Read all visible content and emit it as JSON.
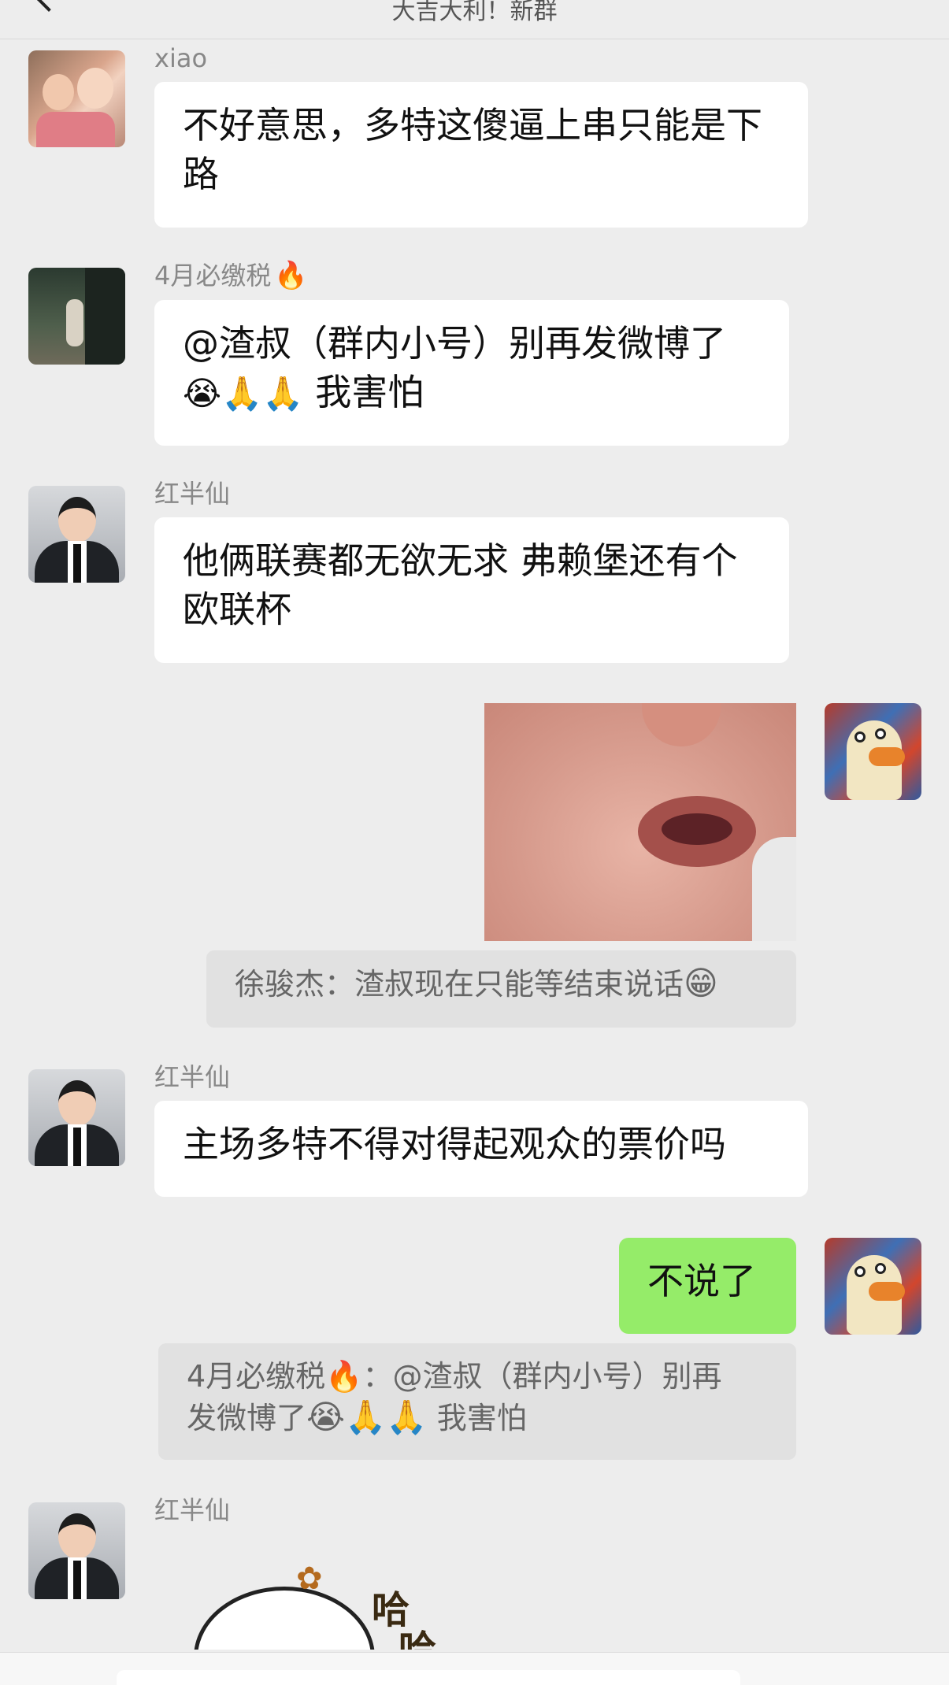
{
  "header": {
    "title": "大吉大利！新群"
  },
  "messages": [
    {
      "sender": "xiao",
      "text": "不好意思，多特这傻逼上串只能是下路"
    },
    {
      "sender": "4月必缴税",
      "sender_emoji": "🔥",
      "text": "@渣叔（群内小号）别再发微博了",
      "emojis": "😭🙏🙏",
      "text_after": "我害怕"
    },
    {
      "sender": "红半仙",
      "text": "他俩联赛都无欲无求  弗赖堡还有个欧联杯"
    },
    {
      "sender": "me",
      "image": "baby-mouth-photo",
      "quote": "徐骏杰：渣叔现在只能等结束说话",
      "quote_emoji": "😁"
    },
    {
      "sender": "红半仙",
      "text": "主场多特不得对得起观众的票价吗"
    },
    {
      "sender": "me",
      "text": "不说了",
      "quote_line1": "4月必缴税🔥：@渣叔（群内小号）别再",
      "quote_line2_text": "发微博了",
      "quote_line2_emojis": "😭🙏🙏",
      "quote_line2_after": "我害怕"
    },
    {
      "sender": "红半仙",
      "sticker": "haha-sticker",
      "sticker_text_1": "哈",
      "sticker_text_2": "哈"
    }
  ],
  "colors": {
    "background": "#ededed",
    "bubble_incoming": "#ffffff",
    "bubble_outgoing": "#95ec69",
    "quote_bg": "#e1e1e1",
    "name_color": "#888888"
  }
}
